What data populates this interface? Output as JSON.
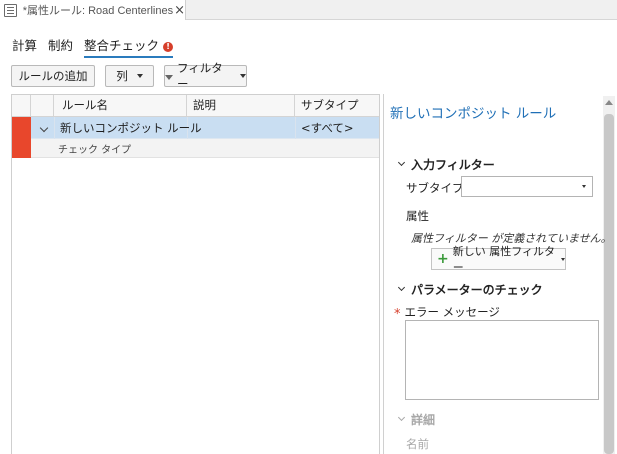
{
  "document_tab": {
    "title": "*属性ルール: Road Centerlines",
    "close": "×"
  },
  "subtabs": [
    {
      "label": "計算"
    },
    {
      "label": "制約"
    },
    {
      "label": "整合チェック",
      "warning": "!"
    }
  ],
  "toolbar": {
    "add_rule": "ルールの追加",
    "columns": "列",
    "filter": "フィルター"
  },
  "table": {
    "columns": [
      "ルール名",
      "説明",
      "サブタイプ"
    ],
    "rows": [
      {
        "name": "新しいコンポジット ルール",
        "description": "",
        "subtype": "<すべて>",
        "detail": "チェック タイプ"
      }
    ]
  },
  "panel": {
    "title": "新しいコンポジット ルール",
    "input_filter": {
      "heading": "入力フィルター",
      "subtype_label": "サブタイプ",
      "subtype_value": "",
      "attribute_label": "属性",
      "empty_message": "属性フィルター が定義されていません。",
      "new_button": "新しい 属性フィルター"
    },
    "parameters": {
      "heading": "パラメーターのチェック",
      "required_mark": "*",
      "error_message_label": "エラー メッセージ",
      "error_message_value": ""
    },
    "details": {
      "heading": "詳細",
      "name_label": "名前"
    }
  },
  "colors": {
    "accent": "#2a7bbd",
    "error": "#e8472c",
    "selection": "#c9def2",
    "title": "#1f6fb6"
  },
  "icons": [
    "attribute-rules-doc-icon",
    "close-icon",
    "warning-icon",
    "chevron-down-icon",
    "filter-icon",
    "plus-icon"
  ]
}
